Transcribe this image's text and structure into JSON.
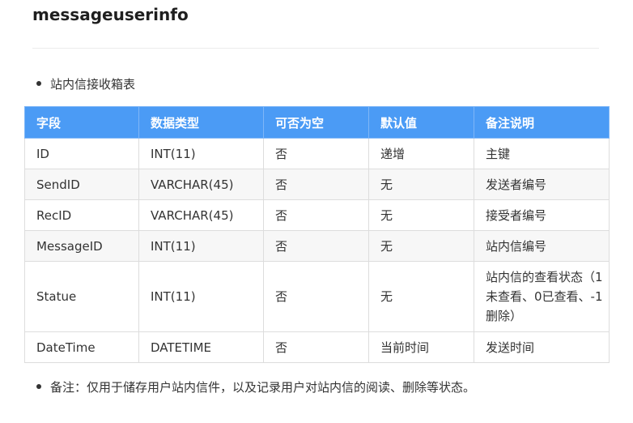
{
  "title": "messageuserinfo",
  "intro": "站内信接收箱表",
  "table": {
    "headers": [
      "字段",
      "数据类型",
      "可否为空",
      "默认值",
      "备注说明"
    ],
    "rows": [
      [
        "ID",
        "INT(11)",
        "否",
        "递增",
        "主键"
      ],
      [
        "SendID",
        "VARCHAR(45)",
        "否",
        "无",
        "发送者编号"
      ],
      [
        "RecID",
        "VARCHAR(45)",
        "否",
        "无",
        "接受者编号"
      ],
      [
        "MessageID",
        "INT(11)",
        "否",
        "无",
        "站内信编号"
      ],
      [
        "Statue",
        "INT(11)",
        "否",
        "无",
        "站内信的查看状态（1未查看、0已查看、-1删除）"
      ],
      [
        "DateTime",
        "DATETIME",
        "否",
        "当前时间",
        "发送时间"
      ]
    ]
  },
  "note": "备注：仅用于储存用户站内信件，以及记录用户对站内信的阅读、删除等状态。"
}
